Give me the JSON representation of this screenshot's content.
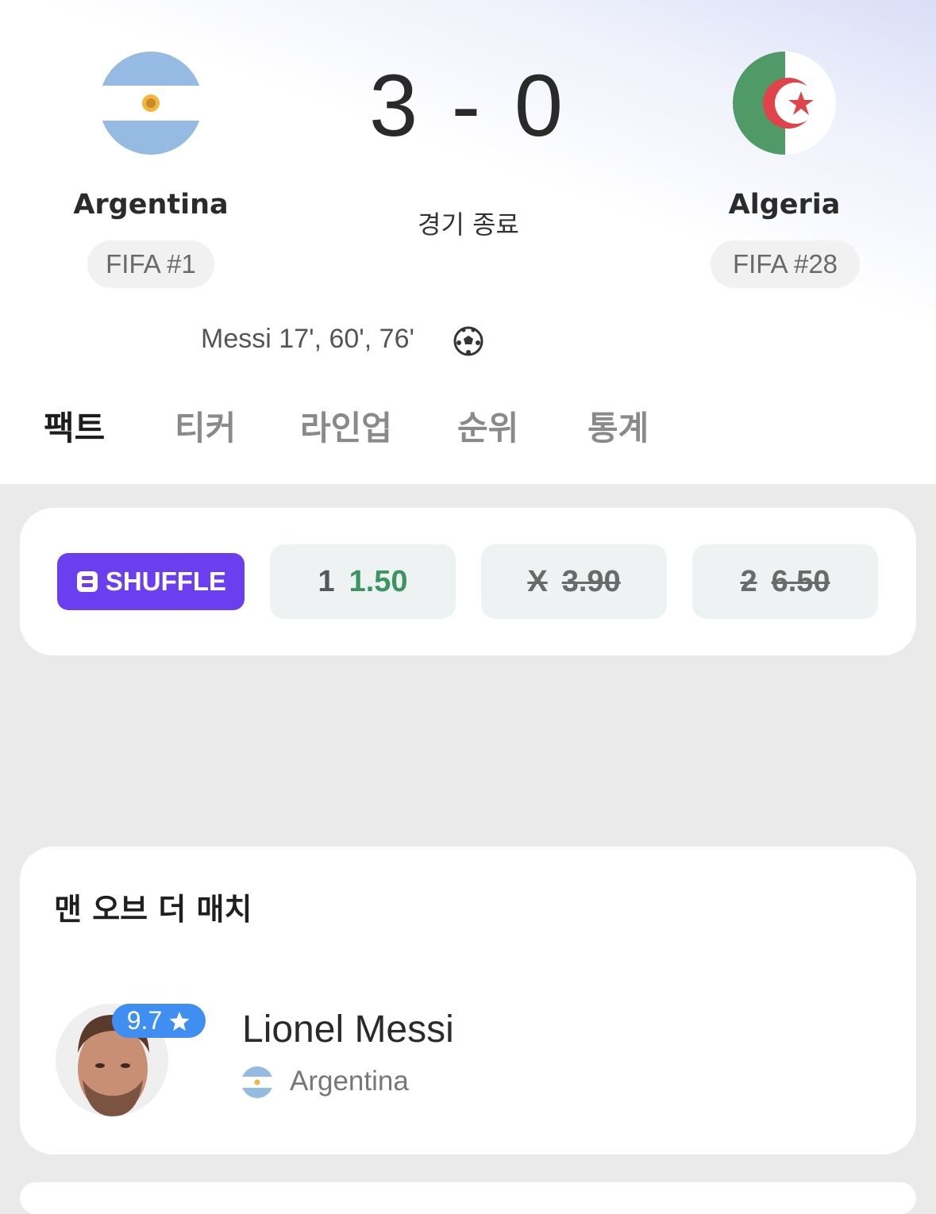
{
  "match": {
    "home": {
      "name": "Argentina",
      "rank": "FIFA #1",
      "flag_icon": "argentina-flag-icon"
    },
    "away": {
      "name": "Algeria",
      "rank": "FIFA #28",
      "flag_icon": "algeria-flag-icon"
    },
    "score": "3 - 0",
    "status": "경기 종료",
    "scorers_home": "Messi 17', 60', 76'"
  },
  "tabs": [
    {
      "label": "팩트",
      "active": true
    },
    {
      "label": "티커",
      "active": false
    },
    {
      "label": "라인업",
      "active": false
    },
    {
      "label": "순위",
      "active": false
    },
    {
      "label": "통계",
      "active": false
    }
  ],
  "odds": {
    "brand": "SHUFFLE",
    "brand_color": "#6b3ff0",
    "items": [
      {
        "label": "1",
        "value": "1.50",
        "struck": false
      },
      {
        "label": "X",
        "value": "3.90",
        "struck": true
      },
      {
        "label": "2",
        "value": "6.50",
        "struck": true
      }
    ]
  },
  "motm": {
    "title": "맨 오브 더 매치",
    "player": "Lionel Messi",
    "rating": "9.7",
    "team": "Argentina"
  },
  "colors": {
    "accent_green": "#3a9560",
    "rating_blue": "#3f8ef2",
    "arg_blue": "#8fb7e2",
    "alg_green": "#4f9a66",
    "alg_red": "#e0444a"
  }
}
